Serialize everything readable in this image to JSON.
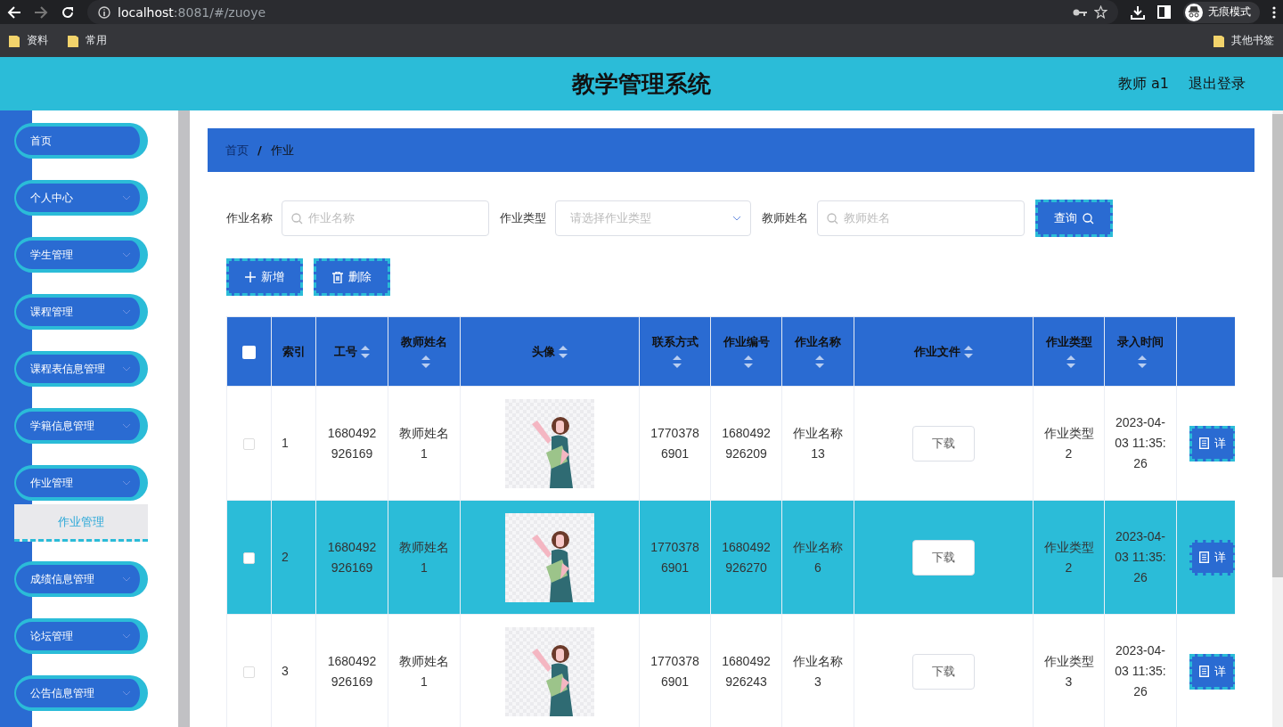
{
  "browser": {
    "host": "localhost",
    "path": ":8081/#/zuoye",
    "profile": "无痕模式",
    "bookmarks": [
      "资料",
      "常用"
    ],
    "other_bookmarks": "其他书签"
  },
  "header": {
    "title": "教学管理系统",
    "user": "教师 a1",
    "logout": "退出登录"
  },
  "sidebar": {
    "items": [
      {
        "label": "首页",
        "expandable": false
      },
      {
        "label": "个人中心",
        "expandable": true
      },
      {
        "label": "学生管理",
        "expandable": true
      },
      {
        "label": "课程管理",
        "expandable": true
      },
      {
        "label": "课程表信息管理",
        "expandable": true
      },
      {
        "label": "学籍信息管理",
        "expandable": true
      },
      {
        "label": "作业管理",
        "expandable": true,
        "children": [
          {
            "label": "作业管理",
            "selected": true
          }
        ]
      },
      {
        "label": "成绩信息管理",
        "expandable": true
      },
      {
        "label": "论坛管理",
        "expandable": true
      },
      {
        "label": "公告信息管理",
        "expandable": true
      }
    ]
  },
  "breadcrumb": {
    "separator": "/",
    "items": [
      "首页",
      "作业"
    ]
  },
  "search": {
    "fields": [
      {
        "kind": "input",
        "label": "作业名称",
        "placeholder": "作业名称"
      },
      {
        "kind": "select",
        "label": "作业类型",
        "placeholder": "请选择作业类型"
      },
      {
        "kind": "input",
        "label": "教师姓名",
        "placeholder": "教师姓名"
      }
    ],
    "button": "查询"
  },
  "actions": [
    {
      "kind": "add",
      "label": "新增"
    },
    {
      "kind": "delete",
      "label": "删除"
    }
  ],
  "table": {
    "all_checked": false,
    "columns": [
      {
        "label": "索引",
        "sortable": false
      },
      {
        "label": "工号",
        "sortable": true
      },
      {
        "label": "教师姓名",
        "sortable": true
      },
      {
        "label": "头像",
        "sortable": true
      },
      {
        "label": "联系方式",
        "sortable": true
      },
      {
        "label": "作业编号",
        "sortable": true
      },
      {
        "label": "作业名称",
        "sortable": true
      },
      {
        "label": "作业文件",
        "sortable": true
      },
      {
        "label": "作业类型",
        "sortable": true
      },
      {
        "label": "录入时间",
        "sortable": true
      }
    ],
    "rows": [
      {
        "checked": false,
        "highlighted": false,
        "index": "1",
        "id": "1680492926169",
        "teacher": "教师姓名1",
        "phone": "17703786901",
        "number": "1680492926209",
        "name": "作业名称13",
        "file": "下载",
        "type": "作业类型2",
        "time": "2023-04-03 11:35:26",
        "detail": "详"
      },
      {
        "checked": false,
        "highlighted": true,
        "index": "2",
        "id": "1680492926169",
        "teacher": "教师姓名1",
        "phone": "17703786901",
        "number": "1680492926270",
        "name": "作业名称6",
        "file": "下载",
        "type": "作业类型2",
        "time": "2023-04-03 11:35:26",
        "detail": "详"
      },
      {
        "checked": false,
        "highlighted": false,
        "index": "3",
        "id": "1680492926169",
        "teacher": "教师姓名1",
        "phone": "17703786901",
        "number": "1680492926243",
        "name": "作业名称3",
        "file": "下载",
        "type": "作业类型3",
        "time": "2023-04-03 11:35:26",
        "detail": "详"
      }
    ]
  }
}
